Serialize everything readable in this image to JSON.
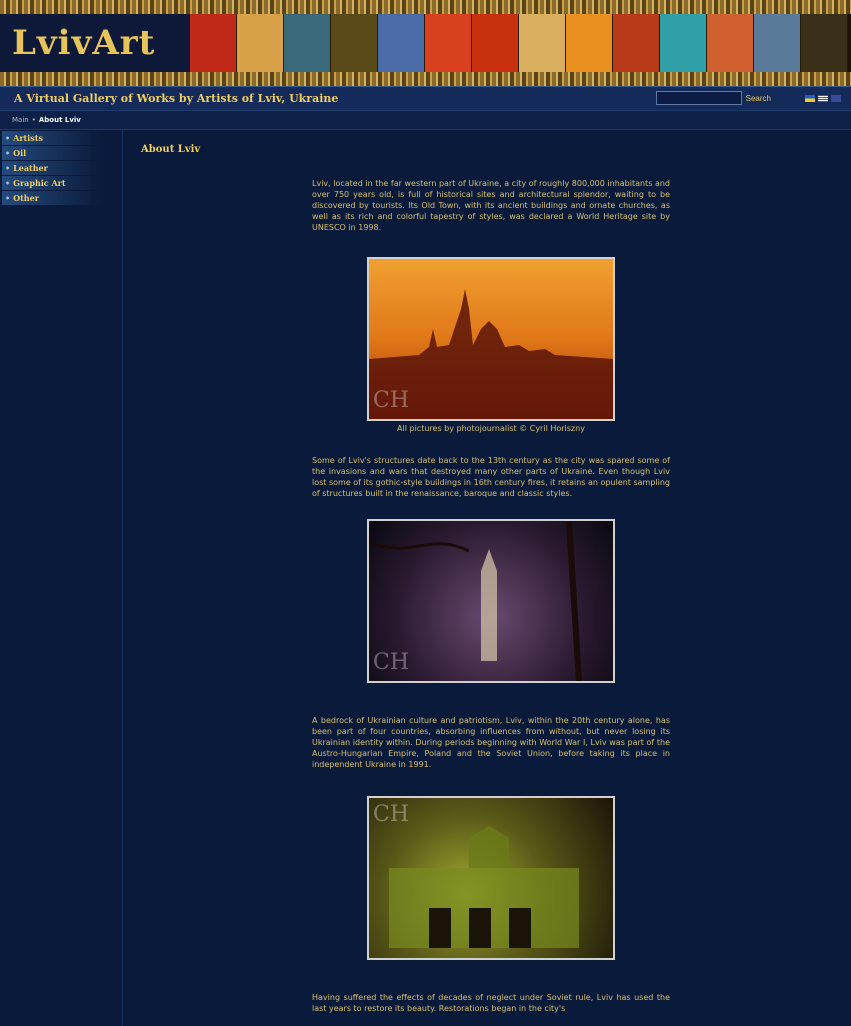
{
  "header": {
    "logo": "LvivArt",
    "tagline": "A Virtual Gallery of Works by Artists of Lviv, Ukraine",
    "search": {
      "placeholder": "",
      "button": "Search"
    },
    "languages": [
      "ua",
      "us",
      "gb"
    ],
    "colors": {
      "accent": "#f0cf5e",
      "background": "#0a1a3a"
    }
  },
  "breadcrumb": {
    "home": "Main",
    "separator": "•",
    "current": "About Lviv"
  },
  "sidebar": {
    "items": [
      {
        "label": "Artists"
      },
      {
        "label": "Oil"
      },
      {
        "label": "Leather"
      },
      {
        "label": "Graphic Art"
      },
      {
        "label": "Other"
      }
    ]
  },
  "main": {
    "title": "About Lviv",
    "paragraphs": [
      "Lviv, located in the far western part of Ukraine, a city of roughly 800,000 inhabitants and over 750 years old, is full of historical sites and architectural splendor, waiting to be discovered by tourists. Its Old Town, with its ancient buildings and ornate churches, as well as its rich and colorful tapestry of styles, was declared a World Heritage site by UNESCO in 1998.",
      "Some of Lviv's structures date back to the 13th century as the city was spared some of the invasions and wars that destroyed many other parts of Ukraine. Even though Lviv lost some of its gothic-style buildings in 16th century fires, it retains an opulent sampling of structures built in the renaissance, baroque and classic styles.",
      "A bedrock of Ukrainian culture and patriotism, Lviv, within the 20th century alone, has been part of four countries, absorbing influences from without, but never losing its Ukrainian identity within. During periods beginning with World War I, Lviv was part of the Austro-Hungarian Empire, Poland and the Soviet Union, before taking its place in independent Ukraine in 1991.",
      "Having suffered the effects of decades of neglect under Soviet rule, Lviv has used the last years to restore its beauty. Restorations began in the city's"
    ],
    "photo_caption": "All pictures by photojournalist © Cyril Horiszny",
    "watermark": "CH"
  }
}
